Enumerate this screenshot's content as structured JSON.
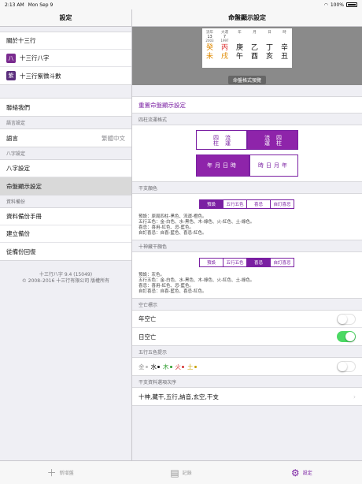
{
  "status": {
    "time": "2:13 AM",
    "date": "Mon Sep 9",
    "battery": "100%"
  },
  "master": {
    "title": "設定",
    "group1": [
      "關於十三行",
      "十三行八字",
      "十三行紫微斗數"
    ],
    "icons": [
      "eight-char-icon",
      "ziwei-icon"
    ],
    "icon_chars": [
      "八",
      "紫"
    ],
    "contact": "聯絡我們",
    "lang_section": "語言設定",
    "lang_label": "語言",
    "lang_value": "繁體中文",
    "bazi_section": "八字設定",
    "bazi_items": [
      "八字設定",
      "命盤顯示設定"
    ],
    "backup_section": "資料備份",
    "backup_items": [
      "資料備份手冊",
      "建立備份",
      "從備份回復"
    ],
    "version": "十三行八字 9.4 (15049)",
    "copyright": "© 2008–2016 十三行有限公司 版權所有"
  },
  "detail": {
    "title": "命盤顯示設定",
    "preview_label": "命盤格式預覽",
    "preview": {
      "cols": [
        {
          "top": "流年",
          "mid": "13",
          "yr": "2003",
          "g": "癸",
          "z": "未",
          "gc": "#e08a00",
          "zc": "#e08a00"
        },
        {
          "top": "大運",
          "mid": "7",
          "yr": "1997",
          "g": "丙",
          "z": "戌",
          "gc": "#d33",
          "zc": "#e08a00"
        },
        {
          "top": "年",
          "mid": "",
          "yr": "",
          "g": "庚",
          "z": "午",
          "gc": "#111",
          "zc": "#111"
        },
        {
          "top": "月",
          "mid": "",
          "yr": "",
          "g": "乙",
          "z": "酉",
          "gc": "#111",
          "zc": "#111"
        },
        {
          "top": "日",
          "mid": "",
          "yr": "",
          "g": "丁",
          "z": "亥",
          "gc": "#111",
          "zc": "#111"
        },
        {
          "top": "時",
          "mid": "",
          "yr": "",
          "g": "辛",
          "z": "丑",
          "gc": "#111",
          "zc": "#111"
        }
      ]
    },
    "reset_label": "重置命盤顯示設定",
    "pillar_section": "四柱流運格式",
    "pillar_opts": [
      {
        "a": "四柱",
        "b": "流運"
      },
      {
        "a": "流運",
        "b": "四柱"
      }
    ],
    "order_opts": [
      "年月日時",
      "時日月年"
    ],
    "stem_section": "干支顏色",
    "seg_labels": [
      "預設",
      "五行五色",
      "喜忌",
      "自訂喜忌"
    ],
    "stem_desc": [
      "預設：原局四柱-黑色、流運-橙色。",
      "五行五色：金-白色、水-黑色、木-綠色、火-紅色、土-綠色。",
      "喜忌：喜用-紅色、忌-藍色。",
      "自訂喜忌：自喜-藍色、喜忌-紅色。"
    ],
    "hidden_section": "十神藏干顏色",
    "hidden_desc": [
      "預設：灰色。",
      "五行五色：金-白色、水-黑色、木-綠色、火-紅色、土-綠色。",
      "喜忌：喜用-紅色、忌-藍色。",
      "自訂喜忌：自喜-藍色、喜忌-紅色。"
    ],
    "void_section": "空亡標示",
    "void_rows": [
      "年空亡",
      "日空亡"
    ],
    "void_states": [
      false,
      true
    ],
    "wx_section": "五行五色提示",
    "wx_items": [
      {
        "t": "金",
        "c": "#bbbbbb"
      },
      {
        "t": "水",
        "c": "#111111"
      },
      {
        "t": "木",
        "c": "#2e9e2e"
      },
      {
        "t": "火",
        "c": "#d33333"
      },
      {
        "t": "土",
        "c": "#c8a000"
      }
    ],
    "order_section": "干支資料選項次序",
    "order_value": "十神,藏干,五行,納音,玄空,干支"
  },
  "tabs": [
    {
      "label": "新增盤",
      "icon": "plus-icon",
      "glyph": "＋"
    },
    {
      "label": "記錄",
      "icon": "records-icon",
      "glyph": "▤"
    },
    {
      "label": "設定",
      "icon": "gear-icon",
      "glyph": "⚙"
    }
  ],
  "colors": {
    "accent": "#7a1fa2",
    "switch_on": "#4cd964"
  }
}
